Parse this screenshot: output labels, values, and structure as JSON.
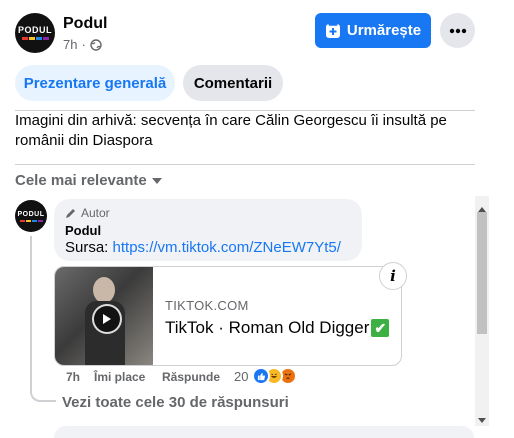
{
  "post": {
    "page_name": "Podul",
    "time": "7h",
    "privacy_icon": "globe-icon",
    "follow_label": "Urmărește",
    "follow_icon": "follow-plus-icon",
    "more_icon": "ellipsis-icon",
    "text": "Imagini din arhivă: secvența în care Călin Georgescu îi insultă pe românii din Diaspora"
  },
  "logo": {
    "text": "PODUL",
    "bar_colors": [
      "#e53935",
      "#fbc02d",
      "#1e88e5",
      "#8e24aa"
    ]
  },
  "tabs": [
    {
      "label": "Prezentare generală",
      "active": true
    },
    {
      "label": "Comentarii",
      "active": false
    }
  ],
  "sort": {
    "label": "Cele mai relevante",
    "icon": "caret-down-icon"
  },
  "comment": {
    "badge_icon": "pen-icon",
    "badge_label": "Autor",
    "author": "Podul",
    "text_prefix": "Sursa: ",
    "link": "https://vm.tiktok.com/ZNeEW7Yt5/",
    "time": "7h",
    "like_label": "Îmi place",
    "reply_label": "Răspunde",
    "reaction_count": "20",
    "reactions": [
      "like",
      "haha",
      "angry"
    ]
  },
  "preview": {
    "domain": "TIKTOK.COM",
    "title": "TikTok · Roman Old Digger",
    "title_emoji": "✔",
    "info_label": "i",
    "play_icon": "play-icon"
  },
  "replies": {
    "label": "Vezi toate cele 30 de răspunsuri"
  },
  "colors": {
    "accent": "#1877f2",
    "secondary_text": "#65676b",
    "bubble": "#f0f2f5"
  }
}
